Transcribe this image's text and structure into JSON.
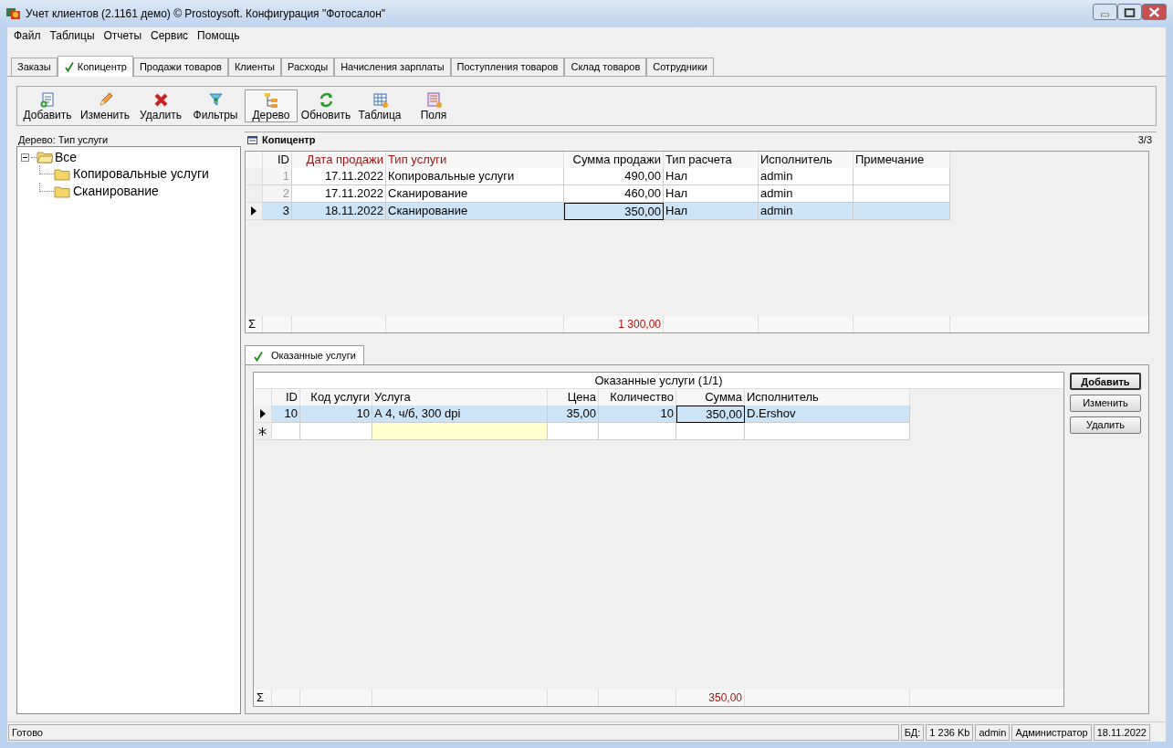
{
  "window": {
    "title": "Учет клиентов (2.1161 демо) © Prostoysoft. Конфигурация \"Фотосалон\""
  },
  "menu": [
    "Файл",
    "Таблицы",
    "Отчеты",
    "Сервис",
    "Помощь"
  ],
  "tabs": [
    {
      "label": "Заказы",
      "selected": false,
      "checked": false
    },
    {
      "label": "Копицентр",
      "selected": true,
      "checked": true
    },
    {
      "label": "Продажи товаров",
      "selected": false,
      "checked": false
    },
    {
      "label": "Клиенты",
      "selected": false,
      "checked": false
    },
    {
      "label": "Расходы",
      "selected": false,
      "checked": false
    },
    {
      "label": "Начисления зарплаты",
      "selected": false,
      "checked": false
    },
    {
      "label": "Поступления товаров",
      "selected": false,
      "checked": false
    },
    {
      "label": "Склад товаров",
      "selected": false,
      "checked": false
    },
    {
      "label": "Сотрудники",
      "selected": false,
      "checked": false
    }
  ],
  "toolbar": [
    {
      "label": "Добавить",
      "kind": "add",
      "pressed": false
    },
    {
      "label": "Изменить",
      "kind": "edit",
      "pressed": false
    },
    {
      "label": "Удалить",
      "kind": "delete",
      "pressed": false
    },
    {
      "label": "Фильтры",
      "kind": "filter",
      "pressed": false
    },
    {
      "label": "Дерево",
      "kind": "tree",
      "pressed": true
    },
    {
      "label": "Обновить",
      "kind": "refresh",
      "pressed": false
    },
    {
      "label": "Таблица",
      "kind": "table",
      "pressed": false
    },
    {
      "label": "Поля",
      "kind": "fields",
      "pressed": false
    }
  ],
  "tree": {
    "label": "Дерево: Тип услуги",
    "items": [
      {
        "label": "Все",
        "expanded": true,
        "selected": false,
        "children": [
          {
            "label": "Копировальные услуги",
            "selected": false
          },
          {
            "label": "Сканирование",
            "selected": false
          }
        ]
      }
    ]
  },
  "grid": {
    "title": "Копицентр",
    "counter": "3/3",
    "sum_sign": "Σ",
    "columns": [
      {
        "label": "ID",
        "kind": "number",
        "highlighted": false,
        "focused": false
      },
      {
        "label": "Дата продажи",
        "kind": "number",
        "highlighted": true,
        "focused": false
      },
      {
        "label": "Тип услуги",
        "kind": "text",
        "highlighted": true,
        "focused": false
      },
      {
        "label": "Сумма продажи",
        "kind": "number",
        "highlighted": false,
        "focused": true,
        "total": "1 300,00"
      },
      {
        "label": "Тип расчета",
        "kind": "text",
        "highlighted": false,
        "focused": false
      },
      {
        "label": "Исполнитель",
        "kind": "text",
        "highlighted": false,
        "focused": false
      },
      {
        "label": "Примечание",
        "kind": "text",
        "highlighted": false,
        "focused": false
      }
    ],
    "rows": [
      {
        "selected": false,
        "cells": [
          "1",
          "17.11.2022",
          "Копировальные услуги",
          "490,00",
          "Нал",
          "admin",
          ""
        ]
      },
      {
        "selected": false,
        "cells": [
          "2",
          "17.11.2022",
          "Сканирование",
          "460,00",
          "Нал",
          "admin",
          ""
        ]
      },
      {
        "selected": true,
        "cells": [
          "3",
          "18.11.2022",
          "Сканирование",
          "350,00",
          "Нал",
          "admin",
          ""
        ]
      }
    ]
  },
  "detail_tabs": [
    {
      "label": "Оказанные услуги",
      "selected": true,
      "checked": true
    }
  ],
  "detail_grid": {
    "title": "Оказанные услуги (1/1)",
    "sum_sign": "Σ",
    "new_row": true,
    "columns": [
      {
        "label": "ID",
        "kind": "number",
        "focused": false,
        "required": false
      },
      {
        "label": "Код услуги",
        "kind": "number",
        "focused": false,
        "required": false
      },
      {
        "label": "Услуга",
        "kind": "text",
        "focused": false,
        "required": true
      },
      {
        "label": "Цена",
        "kind": "number",
        "focused": false,
        "required": false
      },
      {
        "label": "Количество",
        "kind": "number",
        "focused": false,
        "required": false
      },
      {
        "label": "Сумма",
        "kind": "number",
        "focused": true,
        "required": false,
        "total": "350,00"
      },
      {
        "label": "Исполнитель",
        "kind": "text",
        "focused": false,
        "required": false
      }
    ],
    "rows": [
      {
        "selected": true,
        "cells": [
          "10",
          "10",
          "А 4, ч/б, 300 dpi",
          "35,00",
          "10",
          "350,00",
          "D.Ershov"
        ]
      }
    ]
  },
  "detail_buttons": [
    {
      "label": "Добавить",
      "default": true
    },
    {
      "label": "Изменить",
      "default": false
    },
    {
      "label": "Удалить",
      "default": false
    }
  ],
  "status_bar": {
    "text": "Готово",
    "panels": [
      "БД:",
      "1 236 Kb",
      "admin",
      "Администратор",
      "18.11.2022"
    ]
  }
}
